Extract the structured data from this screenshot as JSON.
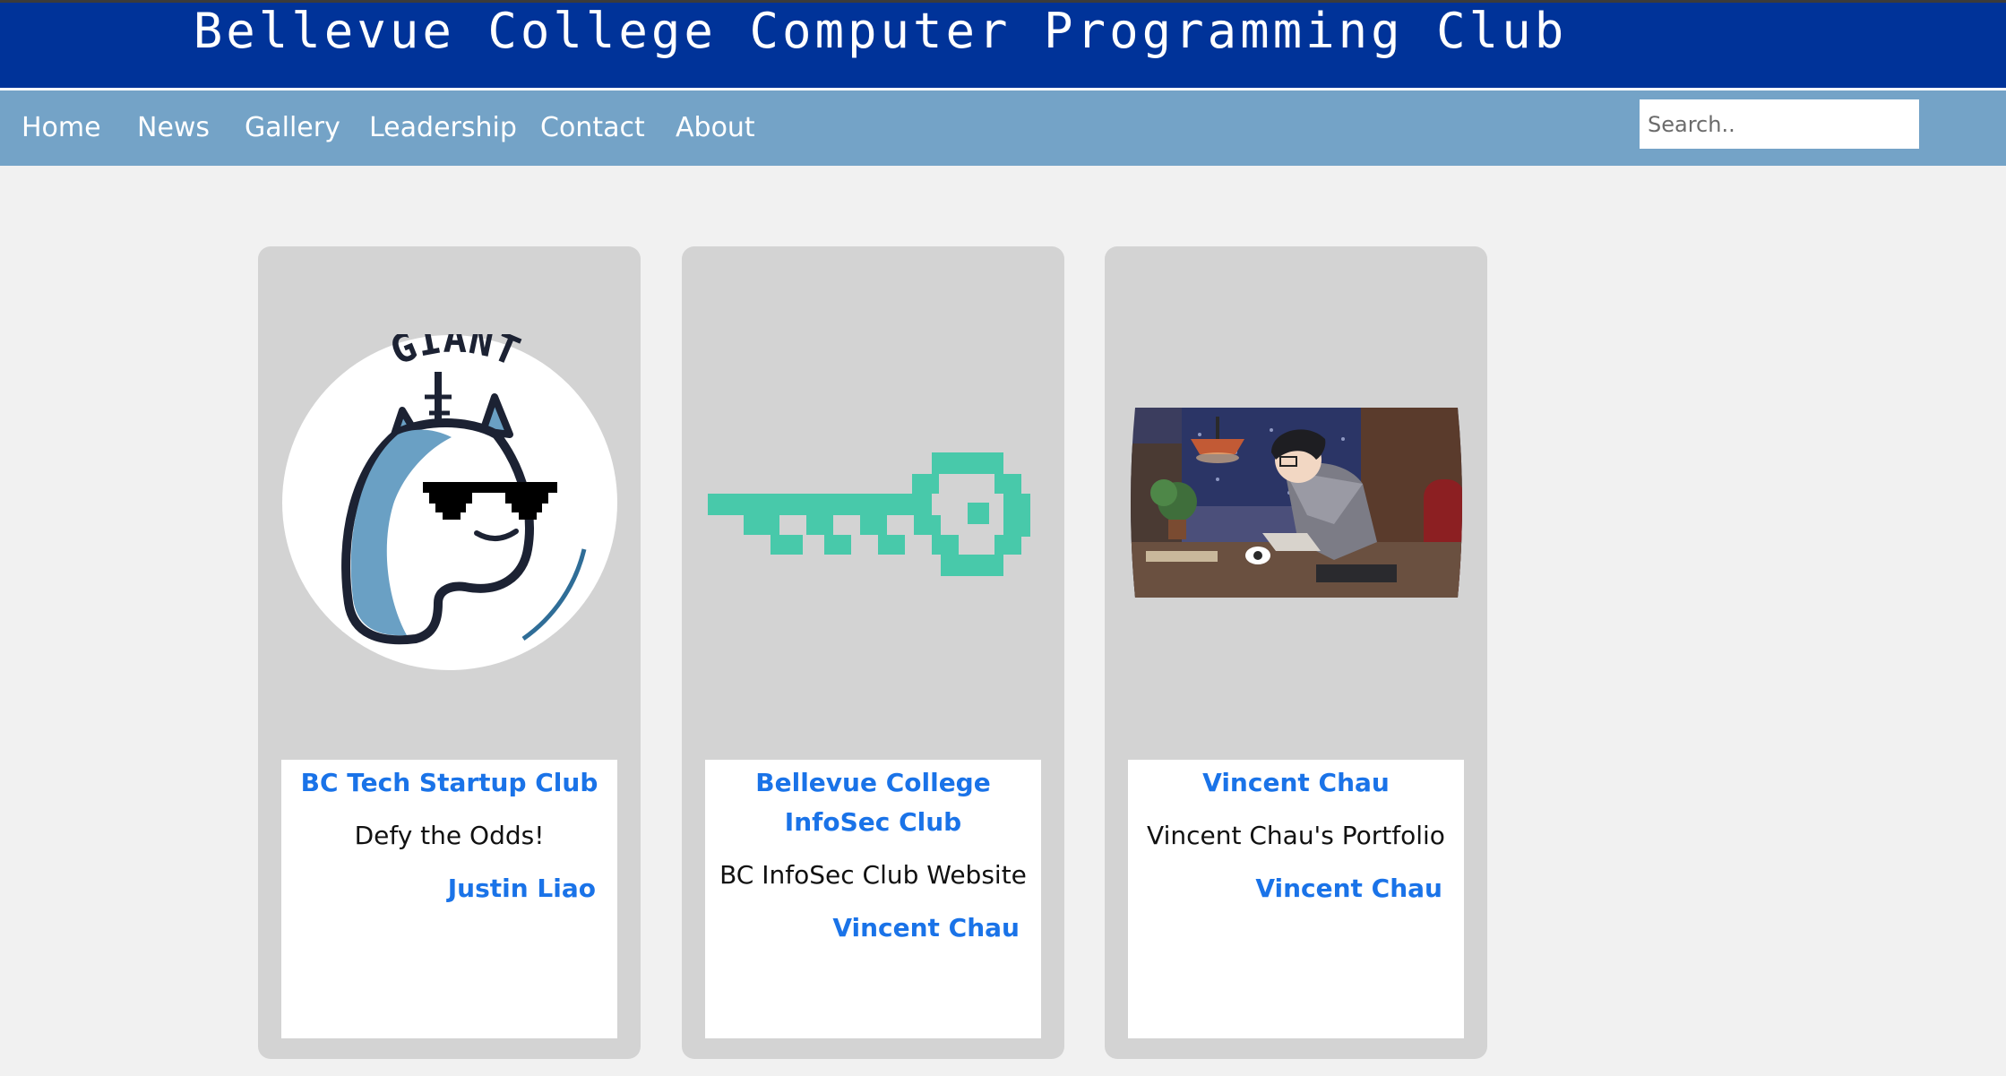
{
  "header": {
    "title": "Bellevue College Computer Programming Club",
    "background_color": "#003399"
  },
  "nav": {
    "background_color": "#74a3c7",
    "items": [
      {
        "label": "Home"
      },
      {
        "label": "News"
      },
      {
        "label": "Gallery"
      },
      {
        "label": "Leadership"
      },
      {
        "label": "Contact"
      },
      {
        "label": "About"
      }
    ],
    "search": {
      "placeholder": "Search..",
      "value": ""
    }
  },
  "cards": [
    {
      "image_icon": "unicorn-with-sunglasses-logo",
      "logo_text": "GIANT",
      "title": "BC Tech Startup Club",
      "description": "Defy the Odds!",
      "author": "Justin Liao"
    },
    {
      "image_icon": "pixel-key-icon",
      "title": "Bellevue College InfoSec Club",
      "description": "BC InfoSec Club Website",
      "author": "Vincent Chau"
    },
    {
      "image_icon": "person-studying-illustration",
      "title": "Vincent Chau",
      "description": "Vincent Chau's Portfolio",
      "author": "Vincent Chau"
    }
  ],
  "colors": {
    "link": "#1a73e8",
    "card_bg": "#d3d3d3",
    "page_bg": "#f1f1f1",
    "key_color": "#48c9aa"
  }
}
